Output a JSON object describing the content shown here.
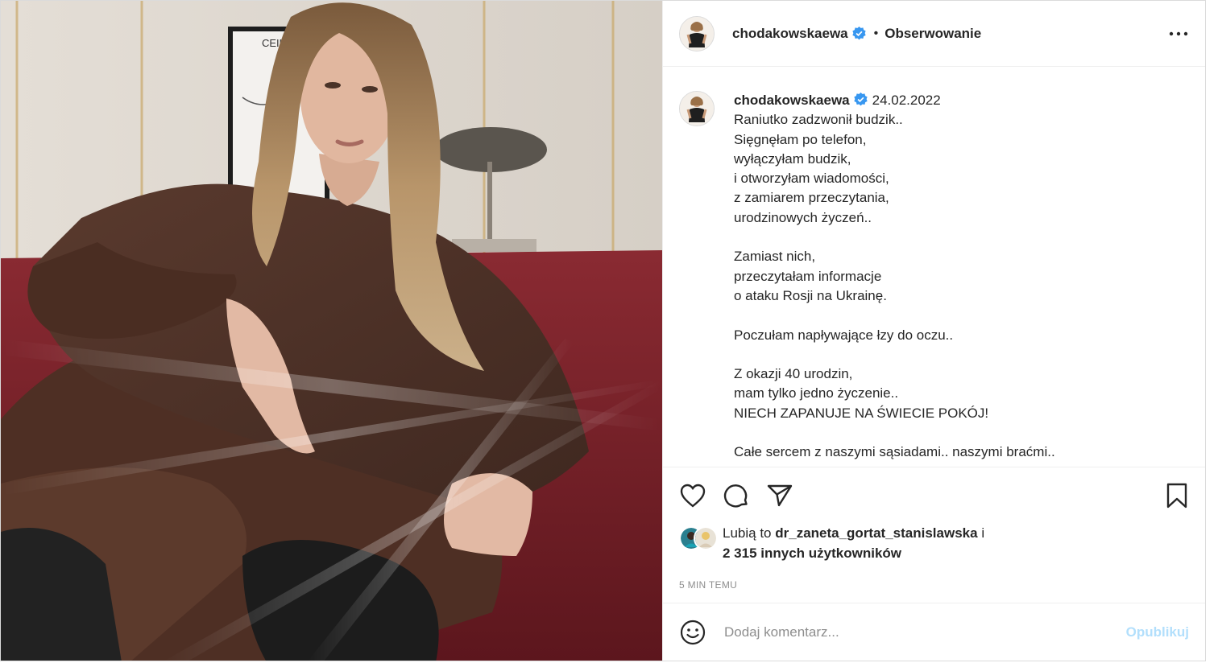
{
  "post": {
    "username": "chodakowskaewa",
    "verified": true,
    "follow_label": "Obserwowanie",
    "date": "24.02.2022",
    "caption_lines": [
      "Raniutko zadzwonił budzik..",
      "Sięgnęłam po telefon,",
      "wyłączyłam budzik,",
      "i otworzyłam wiadomości,",
      "z zamiarem przeczytania,",
      "urodzinowych życzeń..",
      "",
      "Zamiast nich,",
      "przeczytałam informacje",
      "o ataku Rosji na Ukrainę.",
      "",
      "Poczułam napływające łzy do oczu..",
      "",
      "Z okazji 40 urodzin,",
      "mam tylko jedno życzenie..",
      "NIECH ZAPANUJE NA ŚWIECIE POKÓJ!",
      "",
      "Całe sercem z naszymi sąsiadami.. naszymi braćmi.."
    ],
    "likes": {
      "prefix": "Lubią to",
      "user": "dr_zaneta_gortat_stanislawska",
      "connector": "i",
      "count_text": "2 315 innych użytkowników"
    },
    "time_ago": "5 MIN TEMU"
  },
  "comment": {
    "placeholder": "Dodaj komentarz...",
    "publish_label": "Opublikuj"
  },
  "icons": {
    "more": "more-dots-icon",
    "like": "heart-icon",
    "comment": "comment-icon",
    "share": "paper-plane-icon",
    "save": "bookmark-icon",
    "emoji": "smiley-icon",
    "verified": "verified-badge-icon"
  },
  "colors": {
    "verified_blue": "#3897f0",
    "publish_disabled": "#b2dffc",
    "text": "#262626",
    "muted": "#8e8e8e"
  },
  "photo": {
    "poster_text": "CEILING"
  }
}
